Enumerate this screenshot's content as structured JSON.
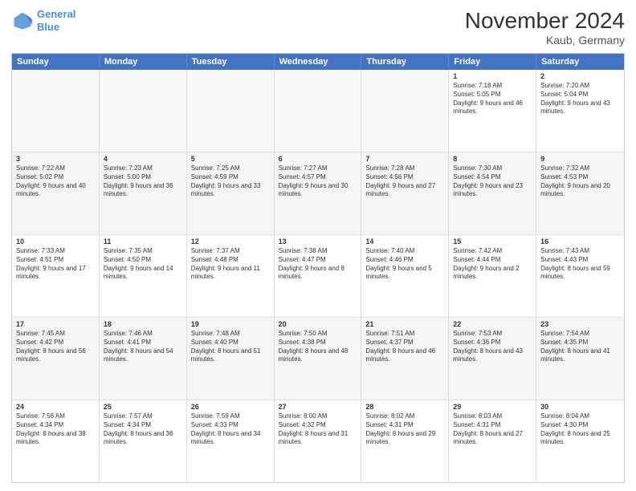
{
  "header": {
    "logo_line1": "General",
    "logo_line2": "Blue",
    "month": "November 2024",
    "location": "Kaub, Germany"
  },
  "days": [
    "Sunday",
    "Monday",
    "Tuesday",
    "Wednesday",
    "Thursday",
    "Friday",
    "Saturday"
  ],
  "weeks": [
    [
      {
        "day": "",
        "info": ""
      },
      {
        "day": "",
        "info": ""
      },
      {
        "day": "",
        "info": ""
      },
      {
        "day": "",
        "info": ""
      },
      {
        "day": "",
        "info": ""
      },
      {
        "day": "1",
        "info": "Sunrise: 7:18 AM\nSunset: 5:05 PM\nDaylight: 9 hours and 46 minutes."
      },
      {
        "day": "2",
        "info": "Sunrise: 7:20 AM\nSunset: 5:04 PM\nDaylight: 9 hours and 43 minutes."
      }
    ],
    [
      {
        "day": "3",
        "info": "Sunrise: 7:22 AM\nSunset: 5:02 PM\nDaylight: 9 hours and 40 minutes."
      },
      {
        "day": "4",
        "info": "Sunrise: 7:23 AM\nSunset: 5:00 PM\nDaylight: 9 hours and 36 minutes."
      },
      {
        "day": "5",
        "info": "Sunrise: 7:25 AM\nSunset: 4:59 PM\nDaylight: 9 hours and 33 minutes."
      },
      {
        "day": "6",
        "info": "Sunrise: 7:27 AM\nSunset: 4:57 PM\nDaylight: 9 hours and 30 minutes."
      },
      {
        "day": "7",
        "info": "Sunrise: 7:28 AM\nSunset: 4:56 PM\nDaylight: 9 hours and 27 minutes."
      },
      {
        "day": "8",
        "info": "Sunrise: 7:30 AM\nSunset: 4:54 PM\nDaylight: 9 hours and 23 minutes."
      },
      {
        "day": "9",
        "info": "Sunrise: 7:32 AM\nSunset: 4:53 PM\nDaylight: 9 hours and 20 minutes."
      }
    ],
    [
      {
        "day": "10",
        "info": "Sunrise: 7:33 AM\nSunset: 4:51 PM\nDaylight: 9 hours and 17 minutes."
      },
      {
        "day": "11",
        "info": "Sunrise: 7:35 AM\nSunset: 4:50 PM\nDaylight: 9 hours and 14 minutes."
      },
      {
        "day": "12",
        "info": "Sunrise: 7:37 AM\nSunset: 4:48 PM\nDaylight: 9 hours and 11 minutes."
      },
      {
        "day": "13",
        "info": "Sunrise: 7:38 AM\nSunset: 4:47 PM\nDaylight: 9 hours and 8 minutes."
      },
      {
        "day": "14",
        "info": "Sunrise: 7:40 AM\nSunset: 4:46 PM\nDaylight: 9 hours and 5 minutes."
      },
      {
        "day": "15",
        "info": "Sunrise: 7:42 AM\nSunset: 4:44 PM\nDaylight: 9 hours and 2 minutes."
      },
      {
        "day": "16",
        "info": "Sunrise: 7:43 AM\nSunset: 4:43 PM\nDaylight: 8 hours and 59 minutes."
      }
    ],
    [
      {
        "day": "17",
        "info": "Sunrise: 7:45 AM\nSunset: 4:42 PM\nDaylight: 8 hours and 56 minutes."
      },
      {
        "day": "18",
        "info": "Sunrise: 7:46 AM\nSunset: 4:41 PM\nDaylight: 8 hours and 54 minutes."
      },
      {
        "day": "19",
        "info": "Sunrise: 7:48 AM\nSunset: 4:40 PM\nDaylight: 8 hours and 51 minutes."
      },
      {
        "day": "20",
        "info": "Sunrise: 7:50 AM\nSunset: 4:38 PM\nDaylight: 8 hours and 48 minutes."
      },
      {
        "day": "21",
        "info": "Sunrise: 7:51 AM\nSunset: 4:37 PM\nDaylight: 8 hours and 46 minutes."
      },
      {
        "day": "22",
        "info": "Sunrise: 7:53 AM\nSunset: 4:36 PM\nDaylight: 8 hours and 43 minutes."
      },
      {
        "day": "23",
        "info": "Sunrise: 7:54 AM\nSunset: 4:35 PM\nDaylight: 8 hours and 41 minutes."
      }
    ],
    [
      {
        "day": "24",
        "info": "Sunrise: 7:56 AM\nSunset: 4:34 PM\nDaylight: 8 hours and 38 minutes."
      },
      {
        "day": "25",
        "info": "Sunrise: 7:57 AM\nSunset: 4:34 PM\nDaylight: 8 hours and 36 minutes."
      },
      {
        "day": "26",
        "info": "Sunrise: 7:59 AM\nSunset: 4:33 PM\nDaylight: 8 hours and 34 minutes."
      },
      {
        "day": "27",
        "info": "Sunrise: 8:00 AM\nSunset: 4:32 PM\nDaylight: 8 hours and 31 minutes."
      },
      {
        "day": "28",
        "info": "Sunrise: 8:02 AM\nSunset: 4:31 PM\nDaylight: 8 hours and 29 minutes."
      },
      {
        "day": "29",
        "info": "Sunrise: 8:03 AM\nSunset: 4:31 PM\nDaylight: 8 hours and 27 minutes."
      },
      {
        "day": "30",
        "info": "Sunrise: 8:04 AM\nSunset: 4:30 PM\nDaylight: 8 hours and 25 minutes."
      }
    ]
  ]
}
